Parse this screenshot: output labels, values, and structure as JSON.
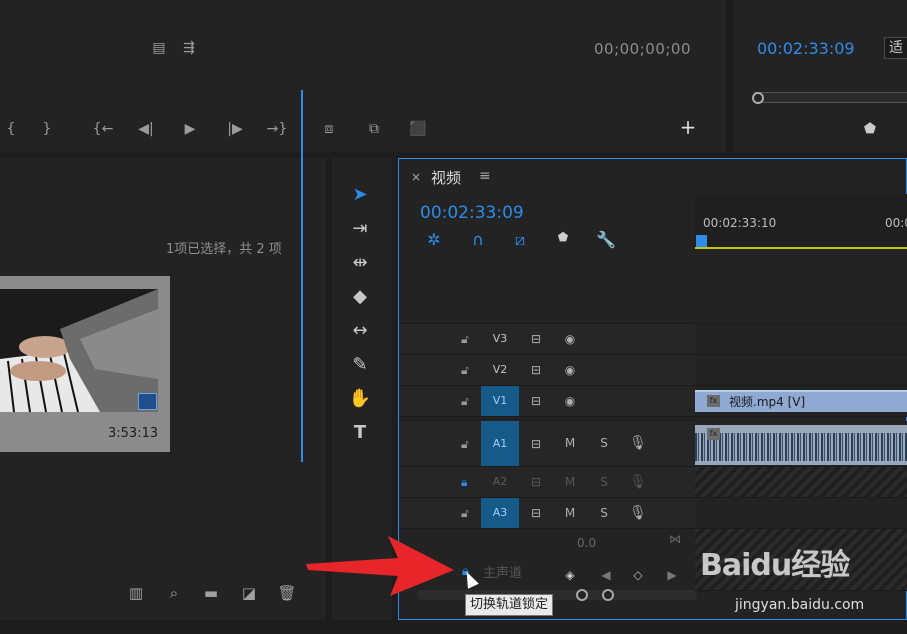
{
  "source_monitor": {
    "timecode": "00;00;00;00",
    "toolbar_icons": [
      "mark-in-icon",
      "mark-out-icon",
      "go-to-in-icon",
      "step-back-icon",
      "play-icon",
      "step-forward-icon",
      "go-to-out-icon",
      "insert-icon",
      "overwrite-icon",
      "export-frame-icon",
      "add-button-icon"
    ],
    "add_label": "+"
  },
  "program_monitor": {
    "timecode": "00:02:33:09",
    "fit_value": "适",
    "marker_icon": "marker-icon"
  },
  "project_panel": {
    "selection_info": "1项已选择，共 2 项",
    "clip_duration": "3:53:13",
    "footer_icons": [
      "automate-icon",
      "find-icon",
      "new-bin-icon",
      "new-item-icon",
      "delete-icon"
    ]
  },
  "tools": [
    "selection-tool",
    "track-select-tool",
    "ripple-edit-tool",
    "razor-tool",
    "slip-tool",
    "pen-tool",
    "hand-tool",
    "type-tool"
  ],
  "timeline": {
    "tab_close": "×",
    "tab_title": "视频",
    "menu": "≡",
    "timecode": "00:02:33:09",
    "ruler_labels": [
      "00:02:33:10",
      "00:0"
    ],
    "tracks": [
      {
        "name": "V3",
        "locked": false,
        "type": "video"
      },
      {
        "name": "V2",
        "locked": false,
        "type": "video"
      },
      {
        "name": "V1",
        "locked": false,
        "type": "video",
        "selected": true
      },
      {
        "name": "A1",
        "locked": false,
        "type": "audio",
        "selected": true
      },
      {
        "name": "A2",
        "locked": true,
        "type": "audio"
      },
      {
        "name": "A3",
        "locked": false,
        "type": "audio",
        "selected": true
      }
    ],
    "audio_buttons": {
      "mute": "M",
      "solo": "S"
    },
    "video_clip_label": "视频.mp4 [V]",
    "fx_label": "fx",
    "master": {
      "value": "0.0",
      "name": "主声道"
    }
  },
  "tooltip": "切换轨道锁定",
  "watermark": {
    "logo": "Baidu经验",
    "url": "jingyan.baidu.com"
  },
  "colors": {
    "accent": "#2d8ceb",
    "arrow": "#e8262a",
    "track_selected": "#165a8a"
  }
}
